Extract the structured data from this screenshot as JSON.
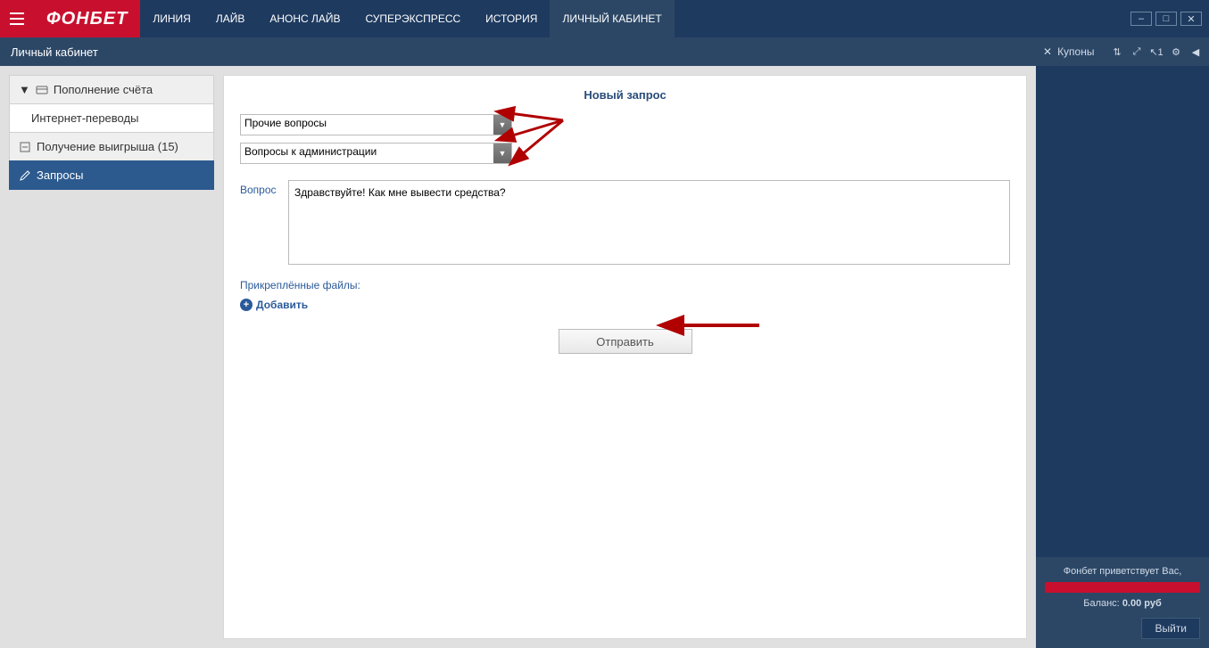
{
  "brand": "ФОНБЕТ",
  "nav": {
    "items": [
      {
        "label": "ЛИНИЯ"
      },
      {
        "label": "ЛАЙВ"
      },
      {
        "label": "АНОНС ЛАЙВ"
      },
      {
        "label": "СУПЕРЭКСПРЕСС"
      },
      {
        "label": "ИСТОРИЯ"
      },
      {
        "label": "ЛИЧНЫЙ КАБИНЕТ"
      }
    ],
    "active_index": 5
  },
  "subheader": {
    "title": "Личный кабинет",
    "close": "Закрыть"
  },
  "sidebar": {
    "items": [
      {
        "label": "Пополнение счёта",
        "type": "header"
      },
      {
        "label": "Интернет-переводы",
        "type": "sub"
      },
      {
        "label": "Получение выигрыша (15)",
        "type": "header"
      },
      {
        "label": "Запросы",
        "type": "active"
      }
    ]
  },
  "form": {
    "title": "Новый запрос",
    "select1": "Прочие вопросы",
    "select2": "Вопросы к администрации",
    "question_label": "Вопрос",
    "question_value": "Здравствуйте! Как мне вывести средства?",
    "attachments_label": "Прикреплённые файлы:",
    "add_label": "Добавить",
    "submit_label": "Отправить"
  },
  "rightpanel": {
    "coupons": "Купоны",
    "greeting": "Фонбет приветствует Вас,",
    "balance_label": "Баланс:",
    "balance_value": "0.00 руб",
    "logout": "Выйти"
  }
}
